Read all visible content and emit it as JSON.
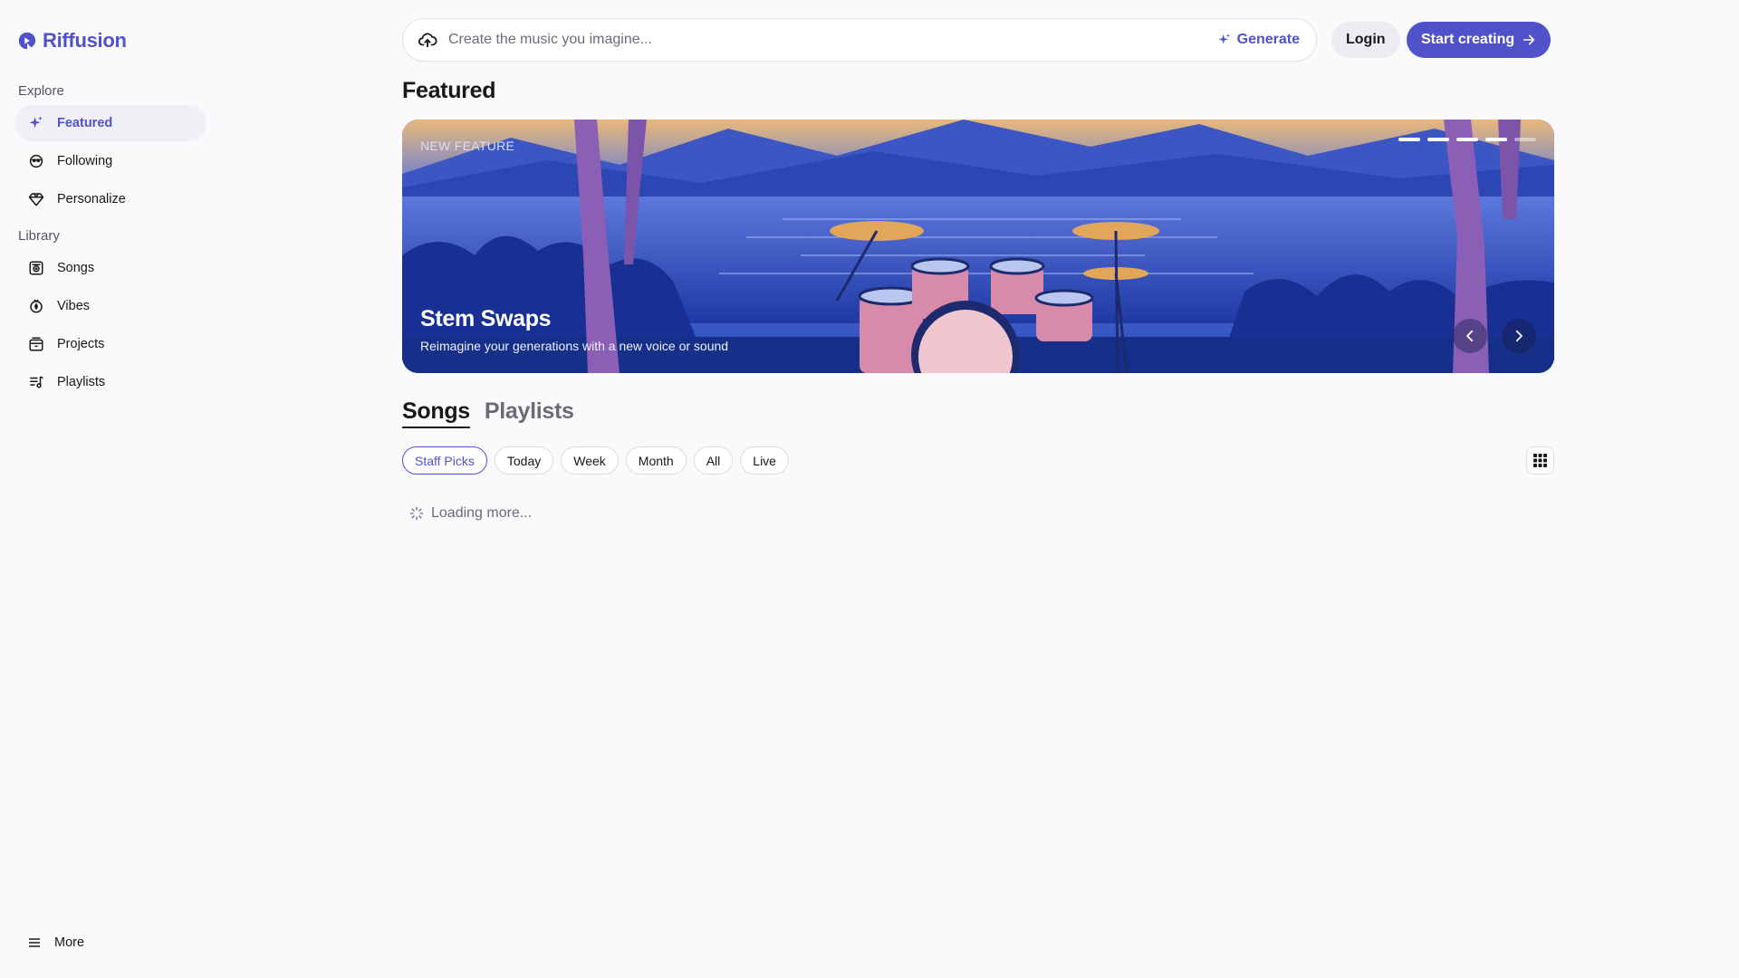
{
  "app": {
    "name": "Riffusion",
    "brand_color": "#4f52c9"
  },
  "sidebar": {
    "explore_label": "Explore",
    "explore_items": [
      {
        "label": "Featured",
        "icon": "sparkles-icon",
        "active": true
      },
      {
        "label": "Following",
        "icon": "following-icon"
      },
      {
        "label": "Personalize",
        "icon": "gem-icon"
      }
    ],
    "library_label": "Library",
    "library_items": [
      {
        "label": "Songs",
        "icon": "songs-icon"
      },
      {
        "label": "Vibes",
        "icon": "vibes-icon"
      },
      {
        "label": "Projects",
        "icon": "projects-icon"
      },
      {
        "label": "Playlists",
        "icon": "playlists-icon"
      }
    ],
    "more_label": "More"
  },
  "header": {
    "search_placeholder": "Create the music you imagine...",
    "generate_label": "Generate",
    "login_label": "Login",
    "start_label": "Start creating"
  },
  "main": {
    "title": "Featured",
    "hero": {
      "eyebrow": "NEW FEATURE",
      "title": "Stem Swaps",
      "subtitle": "Reimagine your generations with a new voice or sound",
      "slide_count": 5,
      "active_slide": 5
    },
    "tabs": [
      {
        "label": "Songs",
        "active": true
      },
      {
        "label": "Playlists",
        "active": false
      }
    ],
    "filters": [
      {
        "label": "Staff Picks",
        "active": true
      },
      {
        "label": "Today"
      },
      {
        "label": "Week"
      },
      {
        "label": "Month"
      },
      {
        "label": "All"
      },
      {
        "label": "Live"
      }
    ],
    "loading_text": "Loading more..."
  }
}
